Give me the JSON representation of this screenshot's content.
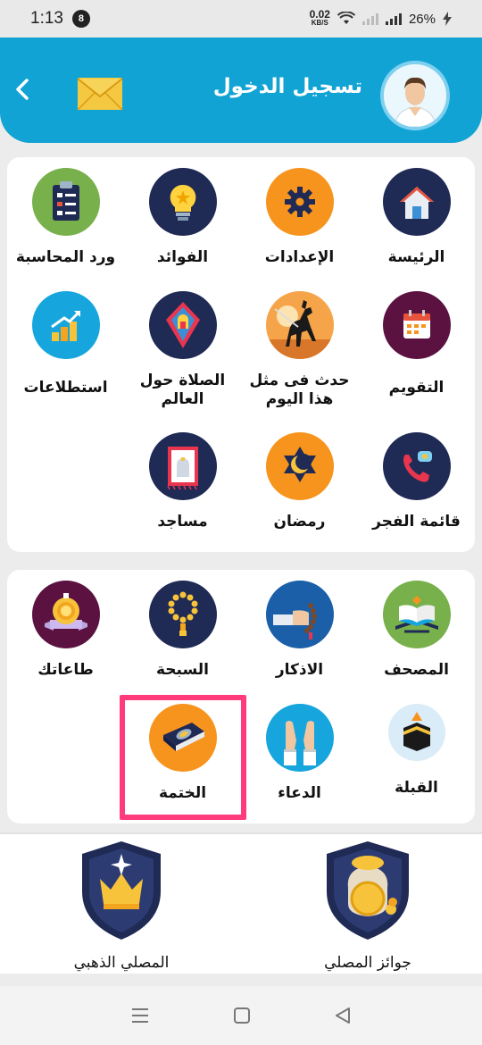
{
  "status_bar": {
    "time": "1:13",
    "notification_count": "8",
    "net_speed_value": "0.02",
    "net_speed_unit": "KB/S",
    "battery": "26%"
  },
  "header": {
    "title": "تسجيل الدخول",
    "back_icon": "chevron-left-icon",
    "mail_icon": "envelope-icon",
    "avatar_icon": "user-avatar-icon",
    "background_color": "#11a3d4"
  },
  "grid1": {
    "items": [
      {
        "label": "الرئيسة",
        "icon": "home-icon"
      },
      {
        "label": "الإعدادات",
        "icon": "gear-icon"
      },
      {
        "label": "الفوائد",
        "icon": "lightbulb-icon"
      },
      {
        "label": "ورد المحاسبة",
        "icon": "clipboard-checklist-icon"
      },
      {
        "label": "التقويم",
        "icon": "calendar-icon"
      },
      {
        "label": "حدث فى مثل هذا اليوم",
        "icon": "horse-rider-icon"
      },
      {
        "label": "الصلاة حول العالم",
        "icon": "prayer-rug-icon"
      },
      {
        "label": "استطلاعات",
        "icon": "bar-chart-icon"
      },
      {
        "label": "قائمة الفجر",
        "icon": "phone-call-icon"
      },
      {
        "label": "رمضان",
        "icon": "crescent-star-icon"
      },
      {
        "label": "مساجد",
        "icon": "mosque-icon"
      }
    ]
  },
  "grid2": {
    "items": [
      {
        "label": "المصحف",
        "icon": "quran-icon"
      },
      {
        "label": "الاذكار",
        "icon": "prayer-beads-hand-icon"
      },
      {
        "label": "السبحة",
        "icon": "tasbih-icon"
      },
      {
        "label": "طاعاتك",
        "icon": "medal-icon"
      },
      {
        "label": "القبلة",
        "icon": "kaaba-icon"
      },
      {
        "label": "الدعاء",
        "icon": "praying-hands-icon"
      },
      {
        "label": "الختمة",
        "icon": "book-icon",
        "highlighted": true
      }
    ]
  },
  "bottom": {
    "rewards_label": "جوائز المصلي",
    "golden_label": "المصلي الذهبي"
  },
  "colors": {
    "highlight": "#ff3b7b",
    "navy": "#1f2a55",
    "orange": "#f7941d"
  }
}
